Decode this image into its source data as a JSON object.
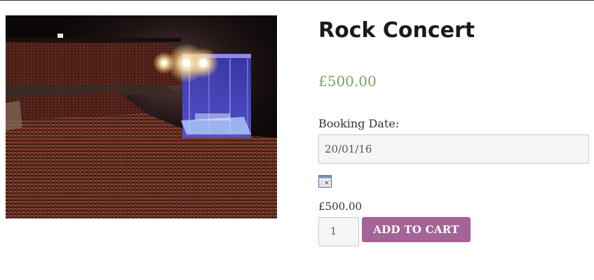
{
  "product": {
    "title": "Rock Concert",
    "price": "£500.00",
    "image_subject": "concert-crowd-photo"
  },
  "booking": {
    "date_label": "Booking Date:",
    "date_value": "20/01/16",
    "calendar_icon": "calendar-icon"
  },
  "cart": {
    "total_price": "£500.00",
    "quantity": "1",
    "add_to_cart_label": "ADD TO CART"
  },
  "colors": {
    "price": "#77a464",
    "button": "#a46497",
    "title": "#1a1a1a",
    "input_bg": "#f5f5f5"
  }
}
